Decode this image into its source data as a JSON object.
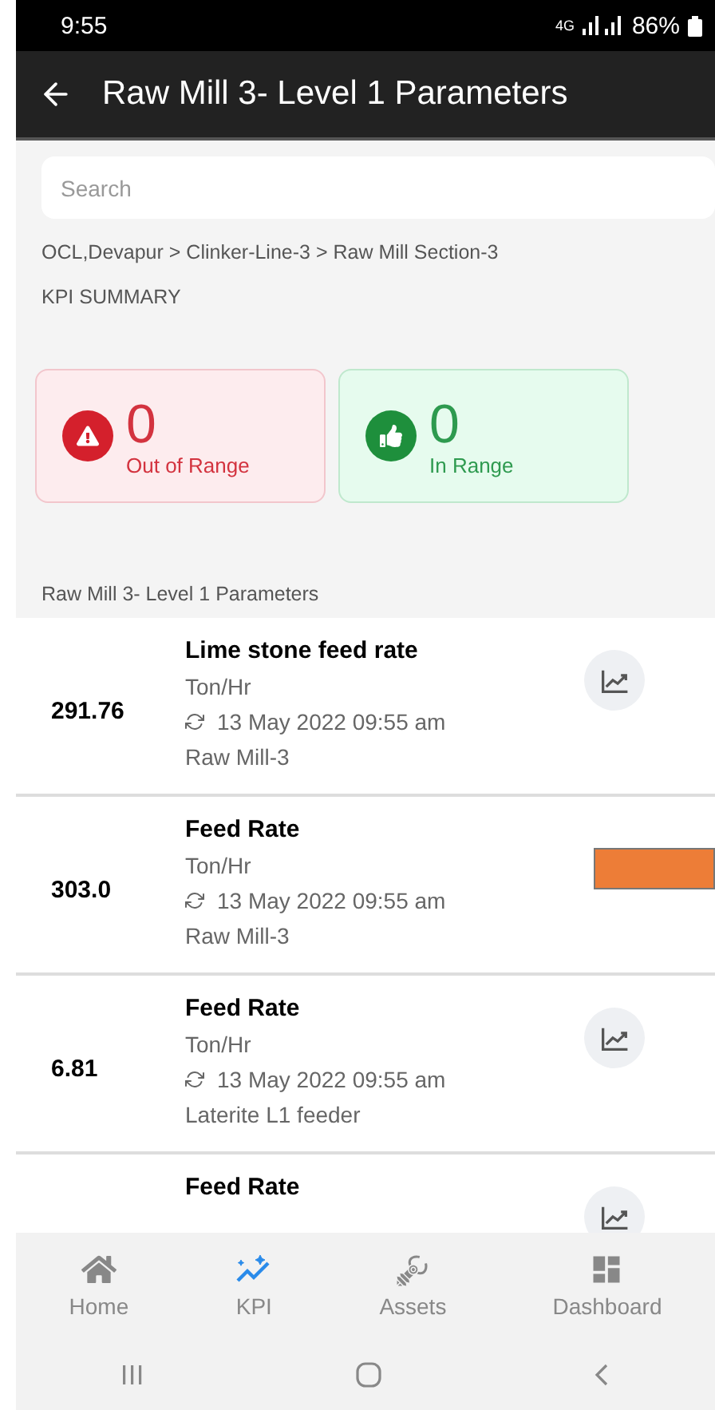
{
  "status_bar": {
    "time": "9:55",
    "network": "4G",
    "battery": "86%"
  },
  "app_bar": {
    "title": "Raw Mill 3- Level 1 Parameters"
  },
  "search": {
    "placeholder": "Search"
  },
  "breadcrumb": "OCL,Devapur > Clinker-Line-3 > Raw Mill Section-3",
  "summary_label": "KPI SUMMARY",
  "summary_cards": [
    {
      "kind": "out",
      "count": "0",
      "label": "Out of Range"
    },
    {
      "kind": "in",
      "count": "0",
      "label": "In Range"
    }
  ],
  "section_title": "Raw Mill 3- Level 1 Parameters",
  "parameters": [
    {
      "value": "291.76",
      "name": "Lime stone feed rate",
      "unit": "Ton/Hr",
      "updated": "13 May 2022 09:55 am",
      "source": "Raw Mill-3",
      "covered": false
    },
    {
      "value": "303.0",
      "name": "Feed Rate",
      "unit": "Ton/Hr",
      "updated": "13 May 2022 09:55 am",
      "source": "Raw Mill-3",
      "covered": true
    },
    {
      "value": "6.81",
      "name": "Feed Rate",
      "unit": "Ton/Hr",
      "updated": "13 May 2022 09:55 am",
      "source": "Laterite L1 feeder",
      "covered": false
    },
    {
      "name": "Feed Rate",
      "covered": false
    }
  ],
  "bottom_nav": [
    {
      "kind": "home",
      "label": "Home",
      "selected": false
    },
    {
      "kind": "kpi",
      "label": "KPI",
      "selected": true
    },
    {
      "kind": "assets",
      "label": "Assets",
      "selected": false
    },
    {
      "kind": "dashboard",
      "label": "Dashboard",
      "selected": false
    }
  ]
}
